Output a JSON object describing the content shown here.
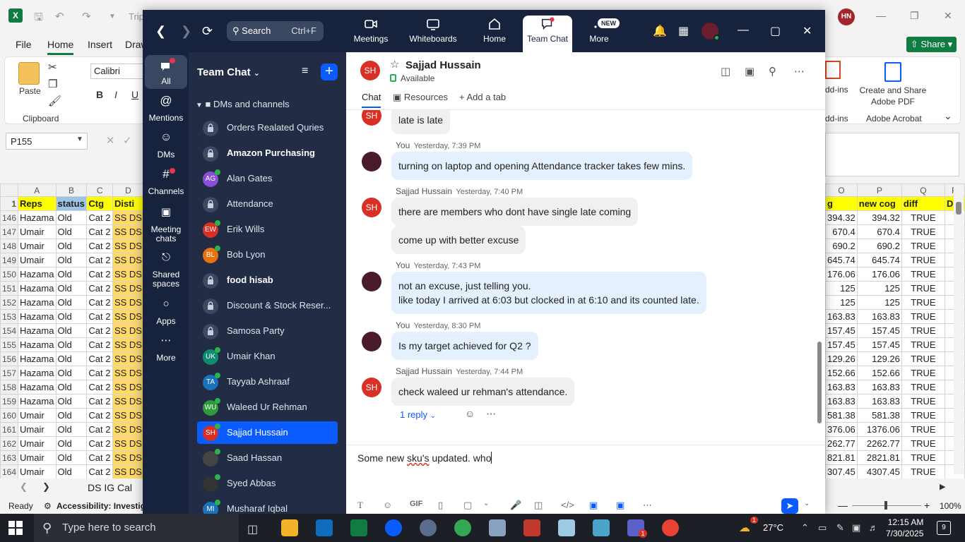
{
  "excel": {
    "doc_name": "Trip",
    "menu": [
      "File",
      "Home",
      "Insert",
      "Draw"
    ],
    "active_menu": "Home",
    "share_label": "Share",
    "ribbon": {
      "paste": "Paste",
      "clipboard": "Clipboard",
      "font_name": "Calibri",
      "bold": "B",
      "italic": "I",
      "underline": "U",
      "addins": "dd-ins",
      "addins2": "dd-ins",
      "adobe_create": "Create and Share Adobe PDF",
      "adobe_group": "Adobe Acrobat"
    },
    "user_initials": "HN",
    "name_box": "P155",
    "columns_left": [
      "A",
      "B",
      "C",
      "D"
    ],
    "columns_right": [
      "O",
      "P",
      "Q",
      "R"
    ],
    "header_row": {
      "rn": "1",
      "reps": "Reps",
      "status": "status",
      "ctg": "Ctg",
      "dist": "Disti",
      "o": "g",
      "p": "new cog",
      "q": "diff",
      "r": "D"
    },
    "rows": [
      {
        "rn": "146",
        "reps": "Hazama",
        "status": "Old",
        "ctg": "Cat 2",
        "dist": "SS DS",
        "o": "394.32",
        "p": "394.32",
        "q": "TRUE"
      },
      {
        "rn": "147",
        "reps": "Umair",
        "status": "Old",
        "ctg": "Cat 2",
        "dist": "SS DS",
        "o": "670.4",
        "p": "670.4",
        "q": "TRUE"
      },
      {
        "rn": "148",
        "reps": "Umair",
        "status": "Old",
        "ctg": "Cat 2",
        "dist": "SS DS",
        "o": "690.2",
        "p": "690.2",
        "q": "TRUE"
      },
      {
        "rn": "149",
        "reps": "Umair",
        "status": "Old",
        "ctg": "Cat 2",
        "dist": "SS DS",
        "o": "645.74",
        "p": "645.74",
        "q": "TRUE"
      },
      {
        "rn": "150",
        "reps": "Hazama",
        "status": "Old",
        "ctg": "Cat 2",
        "dist": "SS DS",
        "o": "176.06",
        "p": "176.06",
        "q": "TRUE"
      },
      {
        "rn": "151",
        "reps": "Hazama",
        "status": "Old",
        "ctg": "Cat 2",
        "dist": "SS DS",
        "o": "125",
        "p": "125",
        "q": "TRUE"
      },
      {
        "rn": "152",
        "reps": "Hazama",
        "status": "Old",
        "ctg": "Cat 2",
        "dist": "SS DS",
        "o": "125",
        "p": "125",
        "q": "TRUE"
      },
      {
        "rn": "153",
        "reps": "Hazama",
        "status": "Old",
        "ctg": "Cat 2",
        "dist": "SS DS",
        "o": "163.83",
        "p": "163.83",
        "q": "TRUE"
      },
      {
        "rn": "154",
        "reps": "Hazama",
        "status": "Old",
        "ctg": "Cat 2",
        "dist": "SS DS",
        "o": "157.45",
        "p": "157.45",
        "q": "TRUE"
      },
      {
        "rn": "155",
        "reps": "Hazama",
        "status": "Old",
        "ctg": "Cat 2",
        "dist": "SS DS",
        "o": "157.45",
        "p": "157.45",
        "q": "TRUE"
      },
      {
        "rn": "156",
        "reps": "Hazama",
        "status": "Old",
        "ctg": "Cat 2",
        "dist": "SS DS",
        "o": "129.26",
        "p": "129.26",
        "q": "TRUE"
      },
      {
        "rn": "157",
        "reps": "Hazama",
        "status": "Old",
        "ctg": "Cat 2",
        "dist": "SS DS",
        "o": "152.66",
        "p": "152.66",
        "q": "TRUE"
      },
      {
        "rn": "158",
        "reps": "Hazama",
        "status": "Old",
        "ctg": "Cat 2",
        "dist": "SS DS",
        "o": "163.83",
        "p": "163.83",
        "q": "TRUE"
      },
      {
        "rn": "159",
        "reps": "Hazama",
        "status": "Old",
        "ctg": "Cat 2",
        "dist": "SS DS",
        "o": "163.83",
        "p": "163.83",
        "q": "TRUE"
      },
      {
        "rn": "160",
        "reps": "Umair",
        "status": "Old",
        "ctg": "Cat 2",
        "dist": "SS DS",
        "o": "581.38",
        "p": "581.38",
        "q": "TRUE"
      },
      {
        "rn": "161",
        "reps": "Umair",
        "status": "Old",
        "ctg": "Cat 2",
        "dist": "SS DS",
        "o": "376.06",
        "p": "1376.06",
        "q": "TRUE"
      },
      {
        "rn": "162",
        "reps": "Umair",
        "status": "Old",
        "ctg": "Cat 2",
        "dist": "SS DS",
        "o": "262.77",
        "p": "2262.77",
        "q": "TRUE"
      },
      {
        "rn": "163",
        "reps": "Umair",
        "status": "Old",
        "ctg": "Cat 2",
        "dist": "SS DS",
        "o": "821.81",
        "p": "2821.81",
        "q": "TRUE"
      },
      {
        "rn": "164",
        "reps": "Umair",
        "status": "Old",
        "ctg": "Cat 2",
        "dist": "SS DS",
        "o": "307.45",
        "p": "4307.45",
        "q": "TRUE"
      }
    ],
    "sheet_tab": "DS IG Cal",
    "status_ready": "Ready",
    "status_accessibility": "Accessibility: Investigate",
    "zoom": "100%"
  },
  "zoom": {
    "search_label": "Search",
    "search_shortcut": "Ctrl+F",
    "tabs": [
      {
        "label": "Meetings",
        "icon": "video-icon"
      },
      {
        "label": "Whiteboards",
        "icon": "whiteboard-icon"
      },
      {
        "label": "Home",
        "icon": "home-icon"
      },
      {
        "label": "Team Chat",
        "icon": "chat-icon"
      },
      {
        "label": "More",
        "icon": "more-icon"
      }
    ],
    "new_badge": "NEW",
    "rail": [
      {
        "label": "All",
        "icon": "chat-bubble-icon"
      },
      {
        "label": "Mentions",
        "icon": "at-icon"
      },
      {
        "label": "DMs",
        "icon": "people-icon"
      },
      {
        "label": "Channels",
        "icon": "hash-icon"
      },
      {
        "label": "Meeting chats",
        "icon": "calendar-icon"
      },
      {
        "label": "Shared spaces",
        "icon": "shared-spaces-icon"
      },
      {
        "label": "Apps",
        "icon": "apps-icon"
      },
      {
        "label": "More",
        "icon": "ellipsis-icon"
      }
    ],
    "sidebar": {
      "title": "Team Chat",
      "section": "DMs and channels",
      "items": [
        {
          "name": "Orders Realated Quries",
          "type": "lock",
          "bold": false
        },
        {
          "name": "Amazon Purchasing",
          "type": "lock",
          "bold": true
        },
        {
          "name": "Alan Gates",
          "type": "avatar",
          "initials": "AG",
          "color": "#8a4fd6",
          "online": true
        },
        {
          "name": "Attendance",
          "type": "lock",
          "bold": false
        },
        {
          "name": "Erik Wills",
          "type": "avatar",
          "initials": "EW",
          "color": "#d93025",
          "online": true
        },
        {
          "name": "Bob Lyon",
          "type": "avatar",
          "initials": "BL",
          "color": "#e8710a",
          "online": true
        },
        {
          "name": "food hisab",
          "type": "lock",
          "bold": true
        },
        {
          "name": "Discount & Stock Reser...",
          "type": "lock",
          "bold": false
        },
        {
          "name": "Samosa Party",
          "type": "lock",
          "bold": false
        },
        {
          "name": "Umair Khan",
          "type": "avatar",
          "initials": "UK",
          "color": "#0f8c6e",
          "online": true
        },
        {
          "name": "Tayyab Ashraaf",
          "type": "avatar",
          "initials": "TA",
          "color": "#1a73b8",
          "online": true
        },
        {
          "name": "Waleed Ur Rehman",
          "type": "avatar",
          "initials": "WU",
          "color": "#2e9b3a",
          "online": true
        },
        {
          "name": "Sajjad Hussain",
          "type": "avatar",
          "initials": "SH",
          "color": "#d93025",
          "online": true,
          "selected": true
        },
        {
          "name": "Saad Hassan",
          "type": "avatar",
          "initials": "",
          "color": "#444444",
          "online": true
        },
        {
          "name": "Syed Abbas",
          "type": "avatar",
          "initials": "",
          "color": "#333333",
          "online": true
        },
        {
          "name": "Musharaf Iqbal",
          "type": "avatar",
          "initials": "MI",
          "color": "#1a73b8",
          "online": true
        }
      ]
    },
    "chat": {
      "contact_name": "Sajjad Hussain",
      "contact_initials": "SH",
      "contact_status": "Available",
      "tabs": [
        "Chat",
        "Resources",
        "Add a tab"
      ],
      "messages": [
        {
          "sender": "",
          "avatar": "SH",
          "time": "",
          "lines": [
            "late is late"
          ],
          "mine": false
        },
        {
          "sender": "You",
          "avatar": "",
          "time": "Yesterday, 7:39 PM",
          "lines": [
            "turning on laptop and opening Attendance tracker takes few mins."
          ],
          "mine": true
        },
        {
          "sender": "Sajjad Hussain",
          "avatar": "SH",
          "time": "Yesterday, 7:40 PM",
          "lines": [
            "there are members who dont have single late coming"
          ],
          "mine": false
        },
        {
          "sender": "",
          "avatar": "",
          "time": "",
          "lines": [
            "come up with better excuse"
          ],
          "mine": false
        },
        {
          "sender": "You",
          "avatar": "",
          "time": "Yesterday, 7:43 PM",
          "lines": [
            "not an excuse, just telling you.",
            "like today I arrived at 6:03 but clocked in at 6:10 and its counted late."
          ],
          "mine": true
        },
        {
          "sender": "You",
          "avatar": "",
          "time": "Yesterday, 8:30 PM",
          "lines": [
            "Is my target achieved for Q2 ?"
          ],
          "mine": true
        },
        {
          "sender": "Sajjad Hussain",
          "avatar": "SH",
          "time": "Yesterday, 7:44 PM",
          "lines": [
            "check waleed ur rehman's attendance."
          ],
          "mine": false
        }
      ],
      "reply_label": "1 reply",
      "compose_before": "Some new ",
      "compose_misspelled": "sku's",
      "compose_after": " updated. who",
      "toolbar_gif": "GIF"
    }
  },
  "taskbar": {
    "search_placeholder": "Type here to search",
    "temperature": "27°C",
    "weather_badge": "1",
    "time": "12:15 AM",
    "date": "7/30/2025",
    "notifications": "9",
    "teams_badge": "1"
  }
}
